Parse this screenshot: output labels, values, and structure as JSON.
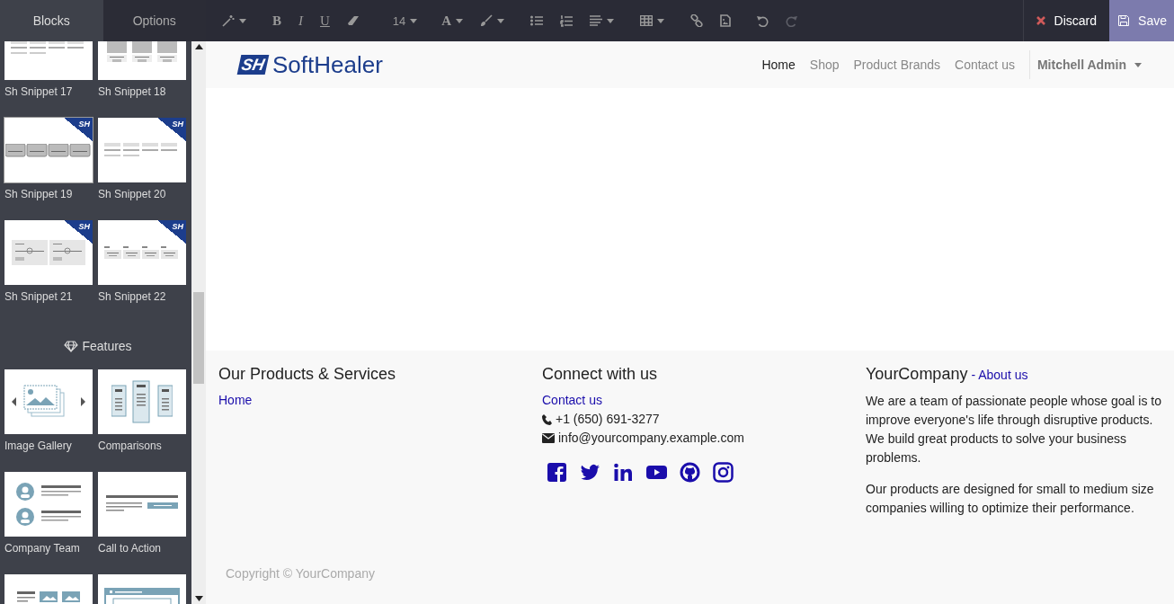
{
  "sidebar": {
    "tabs": [
      {
        "label": "Blocks",
        "selected": true
      },
      {
        "label": "Options",
        "selected": false
      }
    ],
    "groups": [
      {
        "items": [
          {
            "label": "Sh Snippet 17",
            "kind": "lines"
          },
          {
            "label": "Sh Snippet 18",
            "kind": "photos"
          },
          {
            "label": "Sh Snippet 19",
            "kind": "cards",
            "badge": "SH",
            "hovered": true
          },
          {
            "label": "Sh Snippet 20",
            "kind": "lines",
            "badge": "SH"
          },
          {
            "label": "Sh Snippet 21",
            "kind": "sliders",
            "badge": "SH"
          },
          {
            "label": "Sh Snippet 22",
            "kind": "boxes",
            "badge": "SH"
          }
        ]
      },
      {
        "title": "Features",
        "items": [
          {
            "label": "Image Gallery",
            "kind": "gallery"
          },
          {
            "label": "Comparisons",
            "kind": "comparisons"
          },
          {
            "label": "Company Team",
            "kind": "team"
          },
          {
            "label": "Call to Action",
            "kind": "cta"
          },
          {
            "kind": "grid"
          },
          {
            "kind": "window"
          }
        ]
      }
    ]
  },
  "toolbar": [
    {
      "kind": "wand",
      "caret": true
    },
    {
      "kind": "bold",
      "label": "B"
    },
    {
      "kind": "italic",
      "label": "I"
    },
    {
      "kind": "underline",
      "label": "U"
    },
    {
      "kind": "eraser"
    },
    {
      "kind": "text",
      "label": "14",
      "caret": true
    },
    {
      "kind": "color",
      "label": "A",
      "caret": true
    },
    {
      "kind": "brush",
      "caret": true
    },
    {
      "kind": "bullets"
    },
    {
      "kind": "numbers"
    },
    {
      "kind": "align",
      "caret": true
    },
    {
      "kind": "table",
      "caret": true
    },
    {
      "kind": "link"
    },
    {
      "kind": "image"
    },
    {
      "kind": "undo",
      "disabled": false
    },
    {
      "kind": "redo",
      "disabled": true
    }
  ],
  "actions": {
    "discard": "Discard",
    "save": "Save"
  },
  "header": {
    "logo": {
      "mark": "SH",
      "text": "SoftHealer"
    },
    "nav": [
      {
        "label": "Home",
        "selected": true
      },
      {
        "label": "Shop",
        "selected": false
      },
      {
        "label": "Product Brands",
        "selected": false
      },
      {
        "label": "Contact us",
        "selected": false
      }
    ],
    "user": "Mitchell Admin"
  },
  "footer": {
    "columns": [
      {
        "title": "Our Products & Services",
        "links": [
          "Home"
        ]
      },
      {
        "title": "Connect with us",
        "links": [
          "Contact us"
        ],
        "phone": "+1 (650) 691-3277",
        "email": "info@yourcompany.example.com"
      },
      {
        "title": "YourCompany",
        "title_link": "- About us",
        "paragraphs": [
          "We are a team of passionate people whose goal is to improve everyone's life through disruptive products. We build great products to solve your business problems.",
          "Our products are designed for small to medium size companies willing to optimize their performance."
        ]
      }
    ],
    "copyright": "Copyright © YourCompany"
  }
}
